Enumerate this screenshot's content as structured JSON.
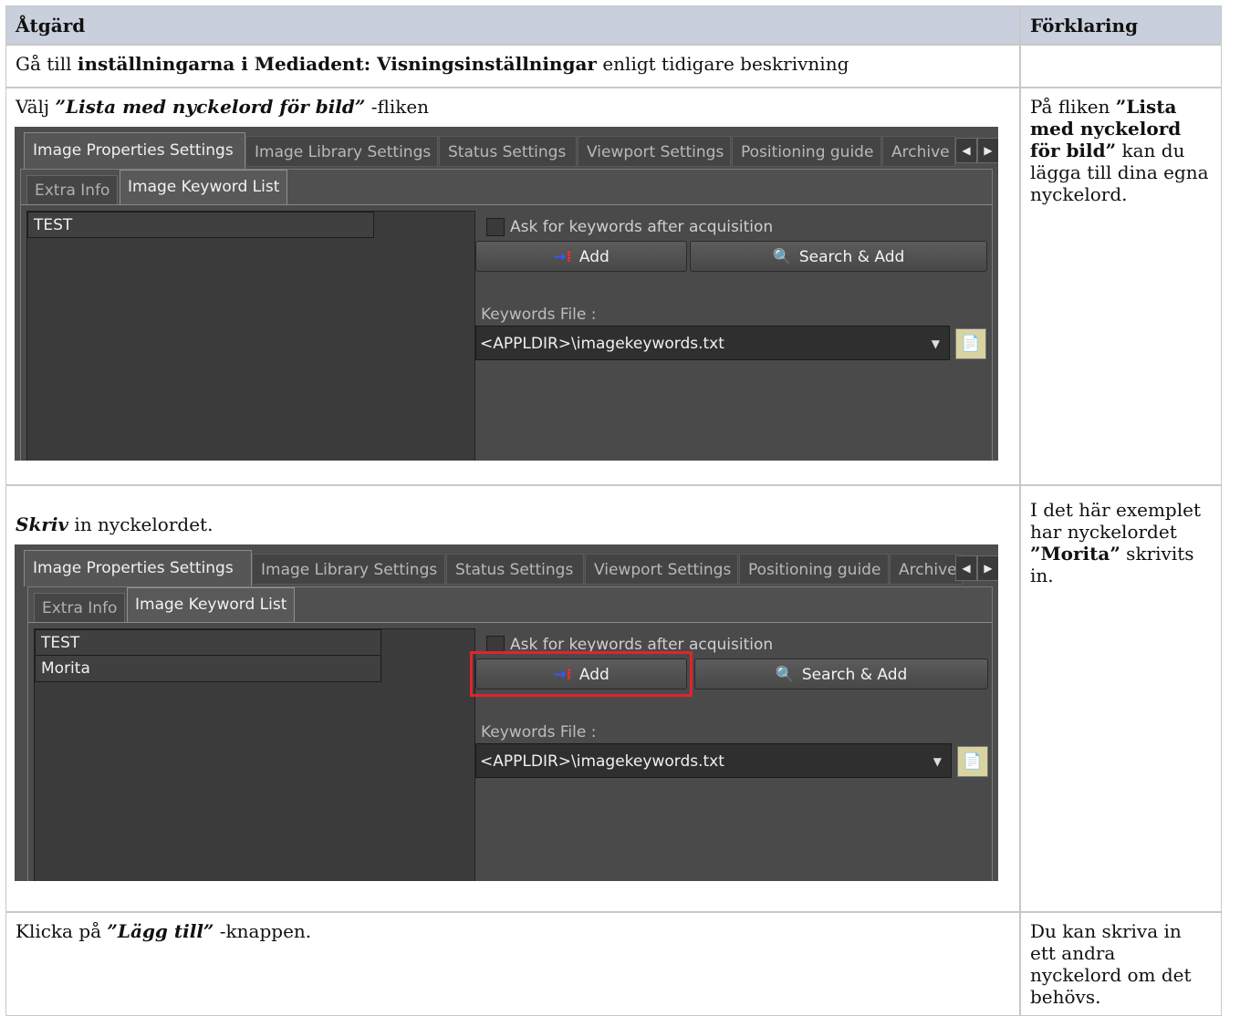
{
  "header": {
    "col_action": "Åtgärd",
    "col_explanation": "Förklaring"
  },
  "rows": [
    {
      "action": {
        "prefix": "Gå till ",
        "bold": "inställningarna i Mediadent: Visningsinställningar",
        "suffix": " enligt tidigare beskrivning"
      },
      "explanation": ""
    },
    {
      "action": {
        "prefix": "Välj ",
        "bold_italic": "”Lista med nyckelord för bild”",
        "suffix": " -fliken"
      },
      "explanation": {
        "prefix": "På fliken ",
        "bold": "”Lista med nyckelord för bild”",
        "suffix": " kan du lägga till dina egna nyckelord."
      }
    },
    {
      "action": {
        "bold_italic": "Skriv",
        "suffix": " in nyckelordet."
      },
      "explanation": {
        "prefix": "I det här exemplet har nyckelordet ",
        "bold": "”Morita”",
        "suffix": " skrivits in."
      }
    },
    {
      "action": {
        "prefix": "Klicka på ",
        "bold_italic": "”Lägg till”",
        "suffix": " -knappen."
      },
      "explanation": "Du kan skriva in ett andra nyckelord om det behövs."
    }
  ],
  "screenshot": {
    "tabs": [
      "Image Properties Settings",
      "Image Library Settings",
      "Status Settings",
      "Viewport Settings",
      "Positioning guide",
      "Archive"
    ],
    "subtabs": [
      "Extra Info",
      "Image Keyword List"
    ],
    "checkbox_label": "Ask for keywords after acquisition",
    "add_label": "Add",
    "search_add_label": "Search & Add",
    "keywords_file_label": "Keywords File :",
    "keywords_file_value": "<APPLDIR>\\imagekeywords.txt",
    "scroll_left": "◀",
    "scroll_right": "▶",
    "combo_arrow": "▼",
    "keywords_first": [
      "TEST"
    ],
    "keywords_second": [
      "TEST",
      "Morita"
    ]
  },
  "colors": {
    "header_bg": "#c9cfdc",
    "dialog_bg": "#4d4d4d",
    "highlight": "#e0242c"
  }
}
